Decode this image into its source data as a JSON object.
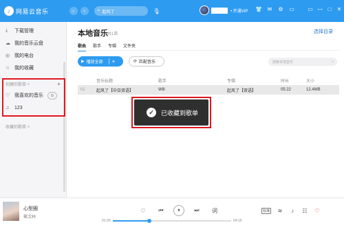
{
  "app": {
    "name": "网易云音乐",
    "logo_glyph": "♪",
    "accent_color": "#2d9bf0",
    "highlight_color": "#e0161e"
  },
  "header": {
    "back_icon": "‹",
    "forward_icon": "›",
    "search_value": "起风了",
    "search_icon": "⌕",
    "mic_icon": "🎙",
    "vip_label": "• 开通VIP",
    "icons": [
      "👕",
      "✉",
      "⚙",
      "▭"
    ],
    "window_controls": [
      "▭",
      "—",
      "□",
      "✕"
    ]
  },
  "sidebar": {
    "items": [
      {
        "icon": "⤓",
        "label": "下载管理"
      },
      {
        "icon": "☁",
        "label": "我的音乐云盘"
      },
      {
        "icon": "◎",
        "label": "我的电台"
      },
      {
        "icon": "☆",
        "label": "我的收藏"
      }
    ],
    "created_section": "创建的歌单 ˄",
    "created_add": "+",
    "playlists": [
      {
        "icon": "♡",
        "label": "我喜欢的音乐",
        "extra": "⊙"
      },
      {
        "icon": "♫",
        "label": "123"
      }
    ],
    "collected_section": "收藏的歌单 ˄"
  },
  "main": {
    "title": "本地音乐",
    "count": "共1首",
    "choose_dir": "选择目录",
    "tabs": [
      "歌曲",
      "歌手",
      "专辑",
      "文件夹"
    ],
    "play_all": "播放全部",
    "play_all_icon": "▶",
    "play_all_add": "+",
    "match_label": "匹配音乐",
    "match_icon": "⟳",
    "local_search_placeholder": "搜索本地音乐",
    "local_search_icon": "⌕",
    "columns": [
      "音乐标题",
      "歌手",
      "专辑",
      "时长",
      "大小"
    ],
    "rows": [
      {
        "index": "01",
        "title": "起风了【中日双语】",
        "artist": "Will",
        "album": "起风了【双语】",
        "duration": "05:22",
        "size": "12.4MB"
      }
    ]
  },
  "toast": {
    "icon": "✓",
    "message": "已收藏到歌单"
  },
  "player": {
    "title": "心型圈",
    "artist": "聚沈林",
    "elapsed": "01:20",
    "total": "04:15",
    "progress": 0.31,
    "controls": [
      "♡",
      "⏮",
      "⏸",
      "⏭",
      "词"
    ],
    "right_controls": [
      "标准",
      "≋",
      "♪",
      "☷"
    ],
    "like_icon": "♡"
  }
}
